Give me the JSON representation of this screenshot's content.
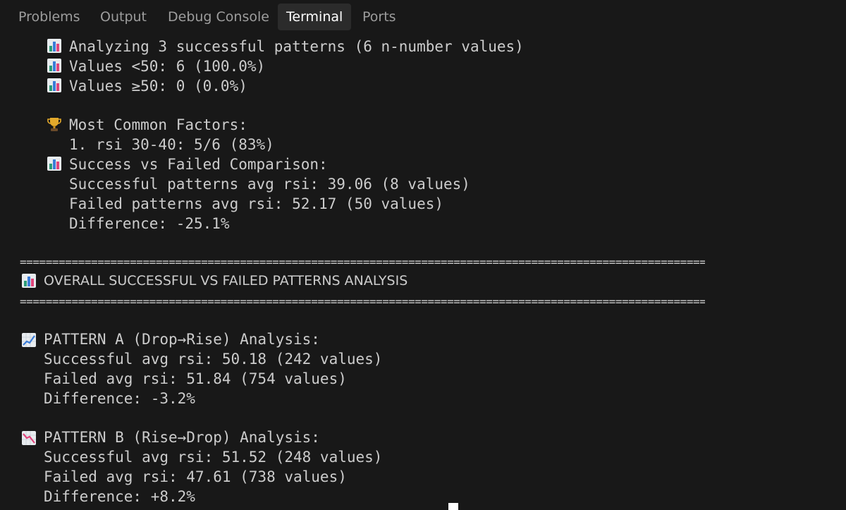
{
  "tabs": {
    "problems": "Problems",
    "output": "Output",
    "debug_console": "Debug Console",
    "terminal": "Terminal",
    "ports": "Ports"
  },
  "active_tab": "Terminal",
  "terminal": {
    "sub": {
      "analyzing": "Analyzing 3 successful patterns (6 n-number values)",
      "values_lt50": "Values <50: 6 (100.0%)",
      "values_ge50": "Values ≥50: 0 (0.0%)",
      "most_common_factors": "Most Common Factors:",
      "factor_1": "1. rsi 30-40: 5/6 (83%)",
      "comparison_title": "Success vs Failed Comparison:",
      "successful_avg": "Successful patterns avg rsi: 39.06 (8 values)",
      "failed_avg": "Failed patterns avg rsi: 52.17 (50 values)",
      "difference": "Difference: -25.1%"
    },
    "separator": "==============================================================================================================",
    "overall_title": "OVERALL SUCCESSFUL VS FAILED PATTERNS ANALYSIS",
    "pattern_a": {
      "title": "PATTERN A (Drop→Rise) Analysis:",
      "successful": "Successful avg rsi: 50.18 (242 values)",
      "failed": "Failed avg rsi: 51.84 (754 values)",
      "difference": "Difference: -3.2%"
    },
    "pattern_b": {
      "title": "PATTERN B (Rise→Drop) Analysis:",
      "successful": "Successful avg rsi: 51.52 (248 values)",
      "failed": "Failed avg rsi: 47.61 (738 values)",
      "difference": "Difference: +8.2%"
    }
  },
  "icons": {
    "bar_chart": "bar-chart-icon",
    "trophy": "trophy-icon",
    "chart_increasing": "chart-increasing-icon",
    "chart_decreasing": "chart-decreasing-icon"
  },
  "colors": {
    "background": "#181818",
    "text": "#cccccc",
    "tab_inactive": "#9d9d9d",
    "tab_active": "#ffffff",
    "tab_active_bg": "#2b2b2b"
  }
}
